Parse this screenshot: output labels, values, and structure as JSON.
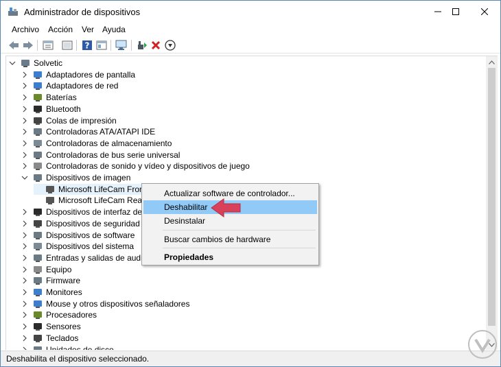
{
  "window": {
    "title": "Administrador de dispositivos",
    "controls": [
      "minimize",
      "maximize",
      "close"
    ]
  },
  "menu": [
    "Archivo",
    "Acción",
    "Ver",
    "Ayuda"
  ],
  "toolbar": {
    "icons": [
      "back-arrow-icon",
      "forward-arrow-icon",
      "properties-icon",
      "console-icon",
      "help-icon",
      "view-icon",
      "monitor-scan-icon",
      "add-driver-icon",
      "uninstall-x-icon",
      "download-icon"
    ]
  },
  "tree": {
    "root": "Solvetic",
    "categories": [
      "Adaptadores de pantalla",
      "Adaptadores de red",
      "Baterías",
      "Bluetooth",
      "Colas de impresión",
      "Controladoras ATA/ATAPI IDE",
      "Controladoras de almacenamiento",
      "Controladoras de bus serie universal",
      "Controladoras de sonido y vídeo y dispositivos de juego",
      "Dispositivos de imagen"
    ],
    "children": [
      "Microsoft LifeCam Front",
      "Microsoft LifeCam Rear"
    ],
    "categories_after": [
      "Dispositivos de interfaz de us",
      "Dispositivos de seguridad",
      "Dispositivos de software",
      "Dispositivos del sistema",
      "Entradas y salidas de audio",
      "Equipo",
      "Firmware",
      "Monitores",
      "Mouse y otros dispositivos señaladores",
      "Procesadores",
      "Sensores",
      "Teclados",
      "Unidades de disco"
    ]
  },
  "context_menu": {
    "items": [
      "Actualizar software de controlador...",
      "Deshabilitar",
      "Desinstalar",
      "Buscar cambios de hardware",
      "Propiedades"
    ],
    "highlighted": "Deshabilitar"
  },
  "status": "Deshabilita el dispositivo seleccionado.",
  "colors": {
    "accent_arrow": "#d9405a",
    "highlight": "#91c9f7",
    "selection": "#e5f1fb"
  }
}
